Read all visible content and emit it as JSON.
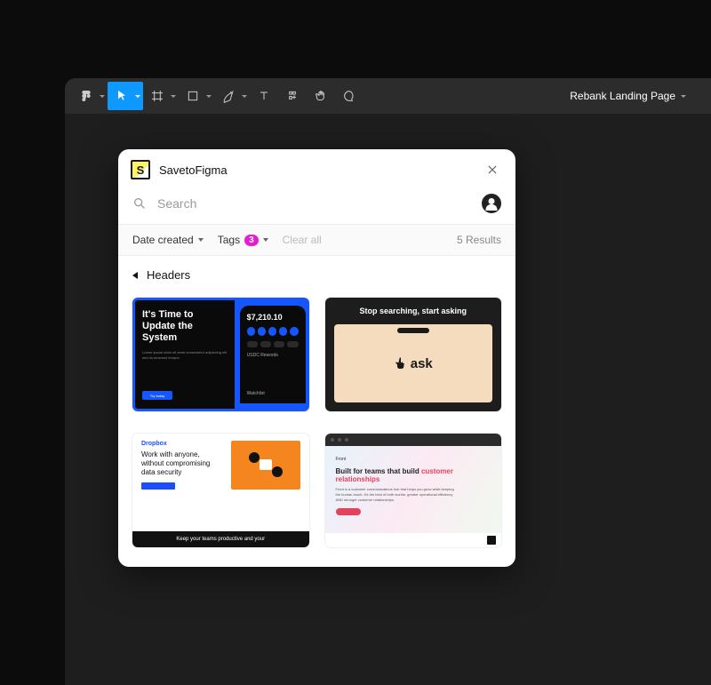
{
  "colors": {
    "figma_active": "#0d99ff",
    "tag_badge": "#e61ed2",
    "card1_accent": "#1656ff",
    "card3_accent": "#f5851f",
    "card4_accent": "#e3425f"
  },
  "document_title": "Rebank Landing Page",
  "plugin": {
    "title": "SavetoFigma",
    "search_placeholder": "Search",
    "filters": {
      "sort_label": "Date created",
      "tags_label": "Tags",
      "tags_count": "3",
      "clear_label": "Clear all",
      "results_text": "5 Results"
    },
    "category": {
      "label": "Headers"
    },
    "results": [
      {
        "title_l1": "It's Time to",
        "title_l2": "Update the",
        "title_l3": "System",
        "phone_amount": "$7,210.10",
        "phone_section": "USDC Rewords",
        "cta": "Try today",
        "watchlist": "Watchlist"
      },
      {
        "title": "Stop searching, start asking",
        "logo": "ask"
      },
      {
        "brand": "Dropbox",
        "title": "Work with anyone, without compromising data security",
        "footer": "Keep your teams productive and your"
      },
      {
        "brand": "Front",
        "title_pre": "Built for teams that build ",
        "title_accent": "customer relationships",
        "body": "Front is a customer communications hub that helps you grow while keeping the human touch. It's the best of both worlds: greater operational efficiency AND stronger customer relationships."
      }
    ]
  }
}
